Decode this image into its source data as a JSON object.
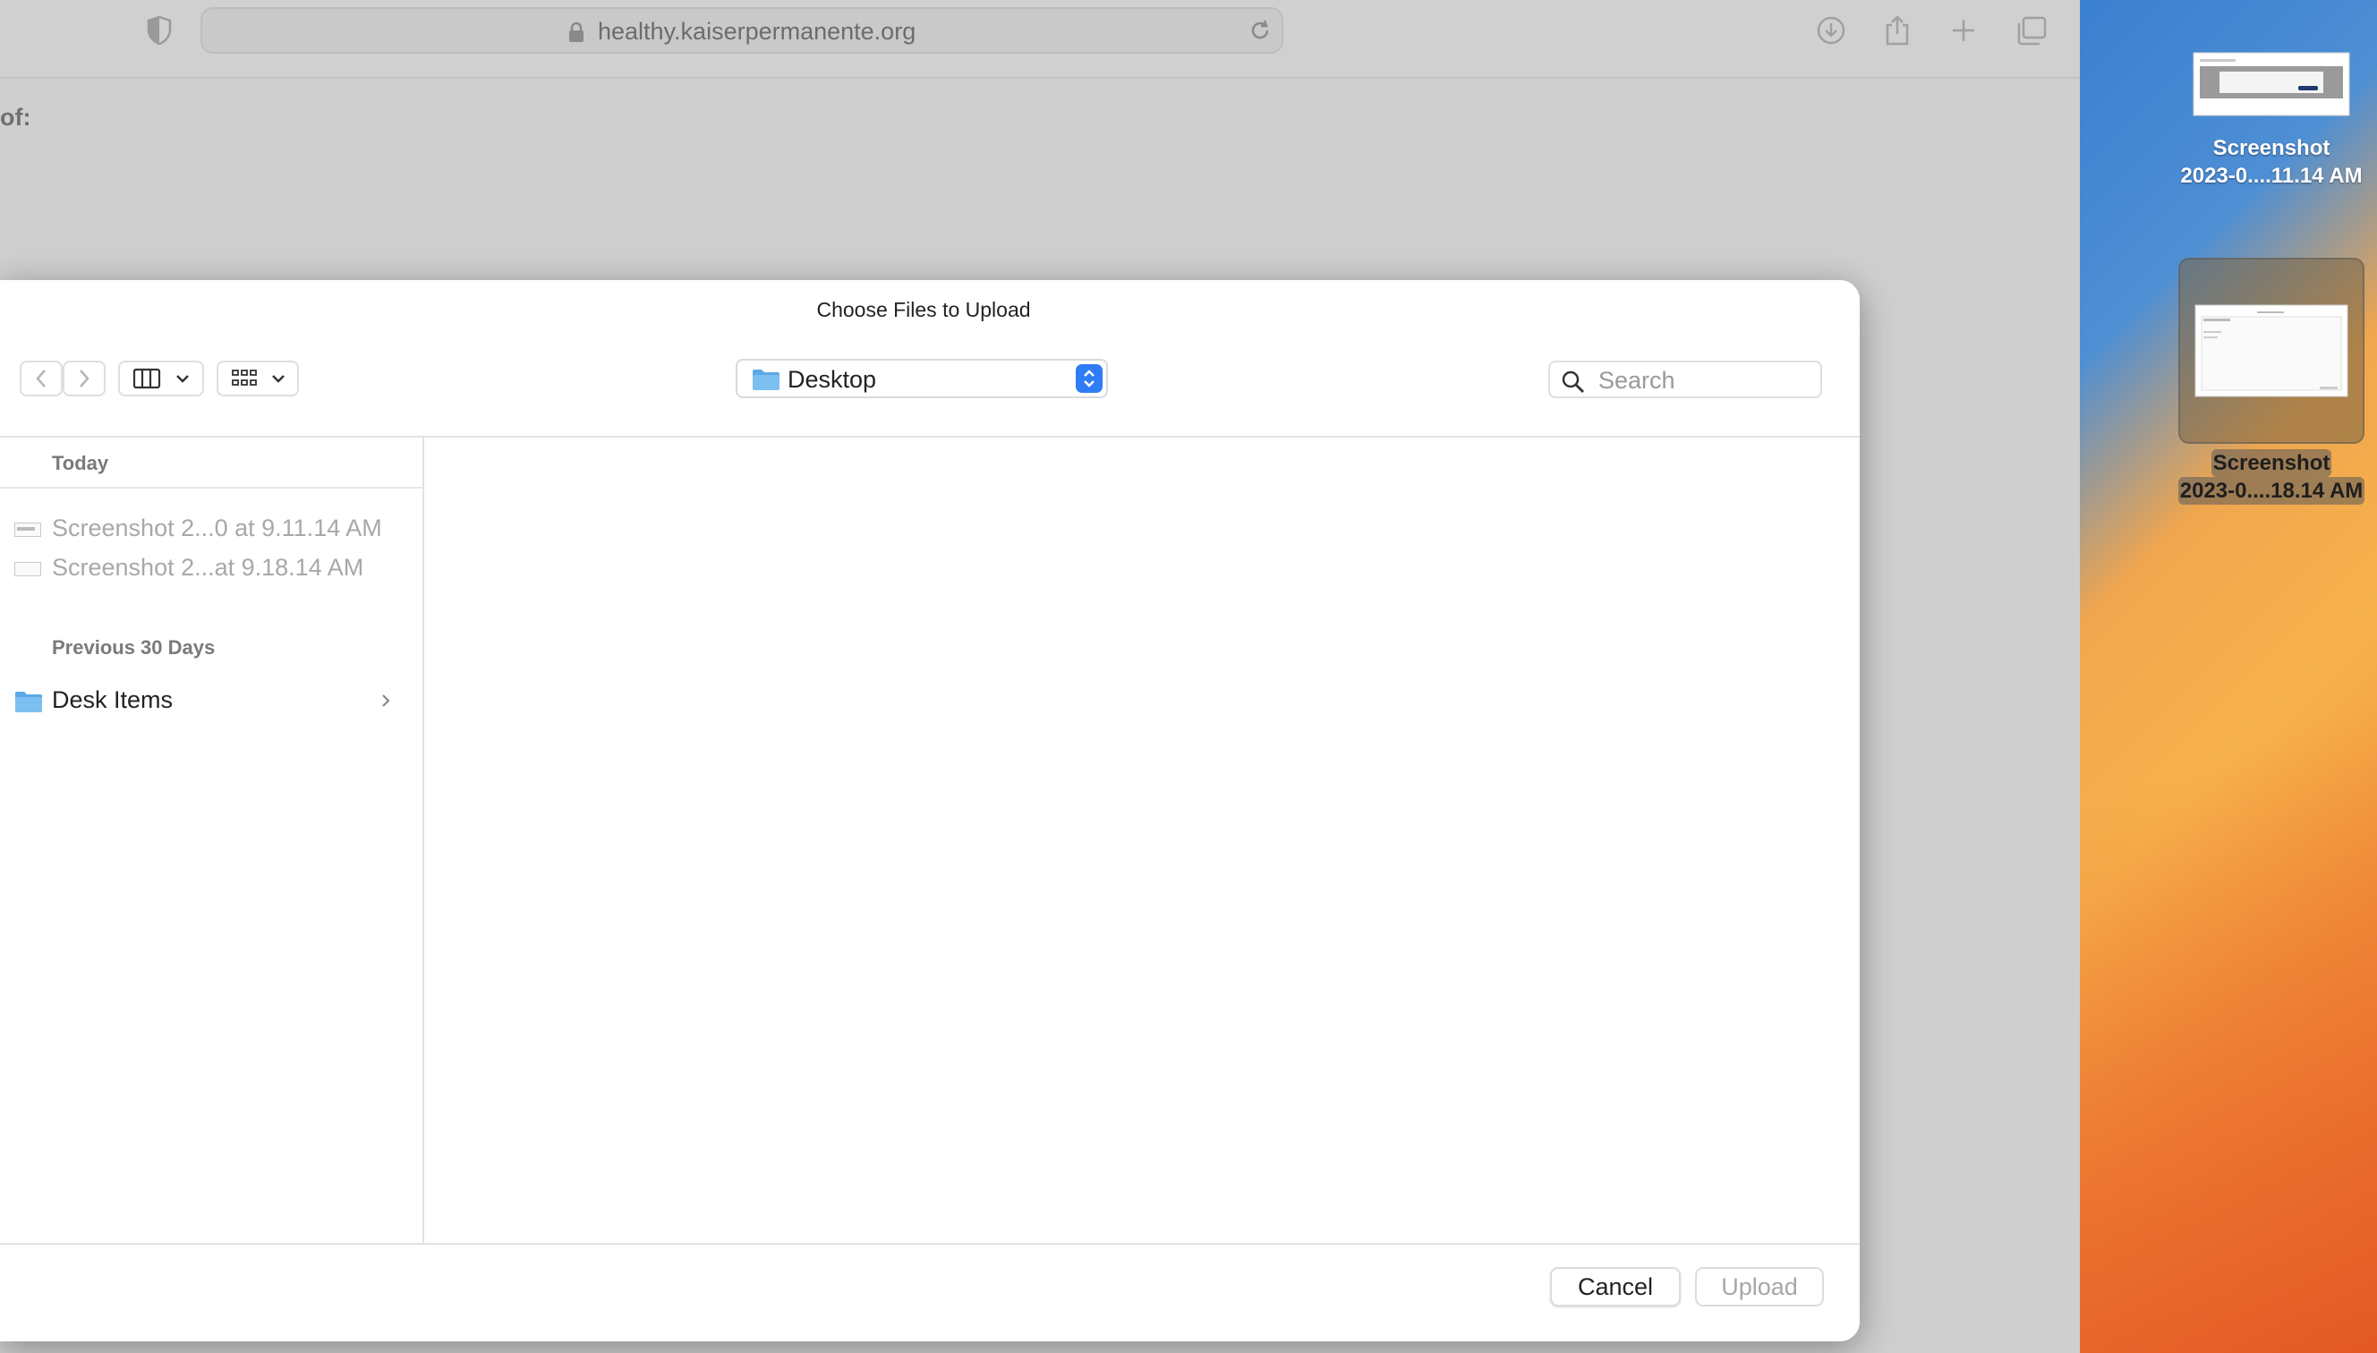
{
  "browser": {
    "url": "healthy.kaiserpermanente.org",
    "page_fragment_text": "of:"
  },
  "desktop": {
    "items": [
      {
        "label_line1": "Screenshot",
        "label_line2": "2023-0....11.14 AM",
        "selected": false
      },
      {
        "label_line1": "Screenshot",
        "label_line2": "2023-0....18.14 AM",
        "selected": true
      }
    ]
  },
  "dialog": {
    "title": "Choose Files to Upload",
    "location": "Desktop",
    "search_placeholder": "Search",
    "sections": {
      "today": "Today",
      "previous": "Previous 30 Days"
    },
    "files": [
      {
        "name": "Screenshot 2...0 at 9.11.14 AM"
      },
      {
        "name": "Screenshot 2...at 9.18.14 AM"
      }
    ],
    "folders": [
      {
        "name": "Desk Items"
      }
    ],
    "cancel_label": "Cancel",
    "upload_label": "Upload"
  },
  "colors": {
    "accent": "#2f7cf6",
    "folder_blue": "#5aa9e6"
  }
}
